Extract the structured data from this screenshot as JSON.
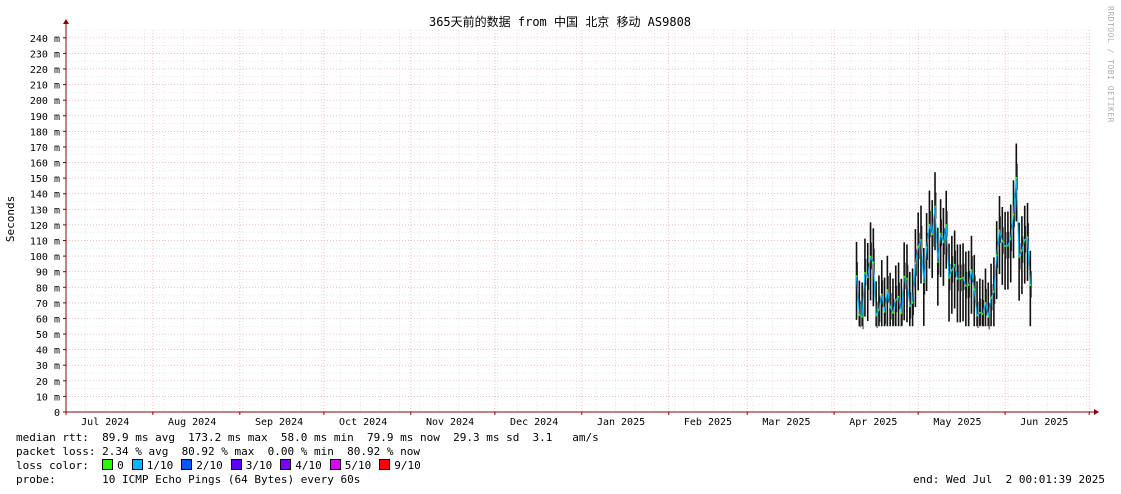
{
  "chart_data": {
    "type": "line",
    "title": "365天前的数据 from 中国 北京 移动 AS9808",
    "ylabel": "Seconds",
    "xlabel": "",
    "y_ticks": [
      "0",
      "10 m",
      "20 m",
      "30 m",
      "40 m",
      "50 m",
      "60 m",
      "70 m",
      "80 m",
      "90 m",
      "100 m",
      "110 m",
      "120 m",
      "130 m",
      "140 m",
      "150 m",
      "160 m",
      "170 m",
      "180 m",
      "190 m",
      "200 m",
      "210 m",
      "220 m",
      "230 m",
      "240 m"
    ],
    "ylim_ms": [
      0,
      245
    ],
    "x_range": [
      "2024-07-01",
      "2025-07-02"
    ],
    "x_ticks": [
      {
        "date": "2024-07-15",
        "label": "Jul 2024"
      },
      {
        "date": "2024-08-15",
        "label": "Aug 2024"
      },
      {
        "date": "2024-09-15",
        "label": "Sep 2024"
      },
      {
        "date": "2024-10-15",
        "label": "Oct 2024"
      },
      {
        "date": "2024-11-15",
        "label": "Nov 2024"
      },
      {
        "date": "2024-12-15",
        "label": "Dec 2024"
      },
      {
        "date": "2025-01-15",
        "label": "Jan 2025"
      },
      {
        "date": "2025-02-15",
        "label": "Feb 2025"
      },
      {
        "date": "2025-03-15",
        "label": "Mar 2025"
      },
      {
        "date": "2025-04-15",
        "label": "Apr 2025"
      },
      {
        "date": "2025-05-15",
        "label": "May 2025"
      },
      {
        "date": "2025-06-15",
        "label": "Jun 2025"
      }
    ],
    "grid": true,
    "series": [
      {
        "name": "median rtt",
        "color": "#000000",
        "points": [
          {
            "x": "2025-04-09",
            "y": 87.1
          },
          {
            "x": "2025-04-10",
            "y": 62.3
          },
          {
            "x": "2025-04-11",
            "y": 61.1
          },
          {
            "x": "2025-04-12",
            "y": 89.2
          },
          {
            "x": "2025-04-13",
            "y": 86.4
          },
          {
            "x": "2025-04-14",
            "y": 99.6
          },
          {
            "x": "2025-04-15",
            "y": 95.8
          },
          {
            "x": "2025-04-16",
            "y": 61.8
          },
          {
            "x": "2025-04-17",
            "y": 65.6
          },
          {
            "x": "2025-04-18",
            "y": 75.4
          },
          {
            "x": "2025-04-19",
            "y": 64.2
          },
          {
            "x": "2025-04-20",
            "y": 78.2
          },
          {
            "x": "2025-04-21",
            "y": 67.3
          },
          {
            "x": "2025-04-22",
            "y": 63.6
          },
          {
            "x": "2025-04-23",
            "y": 72.0
          },
          {
            "x": "2025-04-24",
            "y": 73.9
          },
          {
            "x": "2025-04-25",
            "y": 63.4
          },
          {
            "x": "2025-04-26",
            "y": 86.8
          },
          {
            "x": "2025-04-27",
            "y": 85.5
          },
          {
            "x": "2025-04-28",
            "y": 67.8
          },
          {
            "x": "2025-04-29",
            "y": 70.1
          },
          {
            "x": "2025-04-30",
            "y": 95.3
          },
          {
            "x": "2025-05-01",
            "y": 106.0
          },
          {
            "x": "2025-05-02",
            "y": 110.4
          },
          {
            "x": "2025-05-03",
            "y": 83.2
          },
          {
            "x": "2025-05-04",
            "y": 105.6
          },
          {
            "x": "2025-05-05",
            "y": 120.0
          },
          {
            "x": "2025-05-06",
            "y": 113.9
          },
          {
            "x": "2025-05-07",
            "y": 131.8
          },
          {
            "x": "2025-05-08",
            "y": 96.2
          },
          {
            "x": "2025-05-09",
            "y": 114.5
          },
          {
            "x": "2025-05-10",
            "y": 108.9
          },
          {
            "x": "2025-05-11",
            "y": 119.9
          },
          {
            "x": "2025-05-12",
            "y": 86.0
          },
          {
            "x": "2025-05-13",
            "y": 91.0
          },
          {
            "x": "2025-05-14",
            "y": 94.4
          },
          {
            "x": "2025-05-15",
            "y": 85.5
          },
          {
            "x": "2025-05-16",
            "y": 85.5
          },
          {
            "x": "2025-05-17",
            "y": 86.2
          },
          {
            "x": "2025-05-18",
            "y": 80.9
          },
          {
            "x": "2025-05-19",
            "y": 81.4
          },
          {
            "x": "2025-05-20",
            "y": 91.0
          },
          {
            "x": "2025-05-21",
            "y": 78.6
          },
          {
            "x": "2025-05-22",
            "y": 61.8
          },
          {
            "x": "2025-05-23",
            "y": 63.6
          },
          {
            "x": "2025-05-24",
            "y": 62.9
          },
          {
            "x": "2025-05-25",
            "y": 70.0
          },
          {
            "x": "2025-05-26",
            "y": 61.0
          },
          {
            "x": "2025-05-27",
            "y": 73.1
          },
          {
            "x": "2025-05-28",
            "y": 77.2
          },
          {
            "x": "2025-05-29",
            "y": 100.4
          },
          {
            "x": "2025-05-30",
            "y": 116.5
          },
          {
            "x": "2025-05-31",
            "y": 109.5
          },
          {
            "x": "2025-06-01",
            "y": 106.4
          },
          {
            "x": "2025-06-02",
            "y": 106.6
          },
          {
            "x": "2025-06-03",
            "y": 111.1
          },
          {
            "x": "2025-06-04",
            "y": 126.6
          },
          {
            "x": "2025-06-05",
            "y": 150.2
          },
          {
            "x": "2025-06-06",
            "y": 99.4
          },
          {
            "x": "2025-06-07",
            "y": 103.6
          },
          {
            "x": "2025-06-08",
            "y": 110.3
          },
          {
            "x": "2025-06-09",
            "y": 112.1
          },
          {
            "x": "2025-06-10",
            "y": 81.4
          }
        ]
      }
    ]
  },
  "stats": {
    "median": "median rtt:  89.9 ms avg  173.2 ms max  58.0 ms min  79.9 ms now  29.3 ms sd  3.1   am/s",
    "loss": "packet loss: 2.34 % avg  80.92 % max  0.00 % min  80.92 % now",
    "loss_color_label": "loss color:",
    "probe": "probe:       10 ICMP Echo Pings (64 Bytes) every 60s",
    "end": "end: Wed Jul  2 00:01:39 2025"
  },
  "legend": [
    {
      "label": "0",
      "color": "#26ff00"
    },
    {
      "label": "1/10",
      "color": "#00b8ff"
    },
    {
      "label": "2/10",
      "color": "#0059ff"
    },
    {
      "label": "3/10",
      "color": "#5e00ff"
    },
    {
      "label": "4/10",
      "color": "#7e00ff"
    },
    {
      "label": "5/10",
      "color": "#dd00ff"
    },
    {
      "label": "9/10",
      "color": "#ff0000"
    }
  ],
  "watermark": "RRDTOOL / TOBI OETIKER",
  "colors": {
    "smoke": "#26ff00",
    "grid_major": "#f4a6a6",
    "grid_minor": "#d9d9d9",
    "axis": "#8b0000"
  }
}
